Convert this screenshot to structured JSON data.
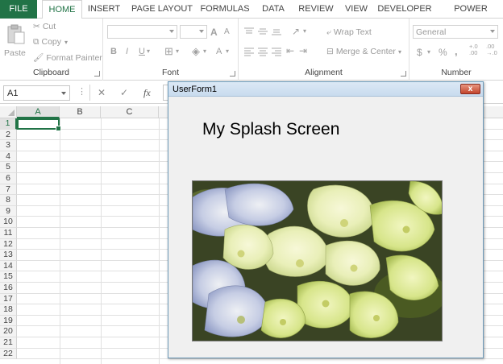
{
  "ribbon": {
    "tabs": [
      {
        "label": "FILE"
      },
      {
        "label": "HOME"
      },
      {
        "label": "INSERT"
      },
      {
        "label": "PAGE LAYOUT"
      },
      {
        "label": "FORMULAS"
      },
      {
        "label": "DATA"
      },
      {
        "label": "REVIEW"
      },
      {
        "label": "VIEW"
      },
      {
        "label": "DEVELOPER"
      },
      {
        "label": "POWER QUERY"
      }
    ],
    "active_tab": "HOME",
    "clipboard": {
      "paste": "Paste",
      "cut": "Cut",
      "copy": "Copy",
      "format_painter": "Format Painter",
      "label": "Clipboard"
    },
    "font": {
      "label": "Font",
      "bold": "B",
      "italic": "I",
      "underline": "U",
      "grow": "A",
      "shrink": "A",
      "font_color": "A"
    },
    "alignment": {
      "label": "Alignment",
      "wrap_text": "Wrap Text",
      "merge_center": "Merge & Center"
    },
    "number": {
      "label": "Number",
      "format": "General",
      "currency": "$",
      "percent": "%",
      "comma": ",",
      "inc_decimal": "+.0\n.00",
      "dec_decimal": ".00\n→.0"
    }
  },
  "formula_bar": {
    "name_box": "A1",
    "cancel_icon": "✕",
    "enter_icon": "✓",
    "fx": "fx"
  },
  "grid": {
    "columns": [
      "A",
      "B",
      "C"
    ],
    "rows": [
      "1",
      "2",
      "3",
      "4",
      "5",
      "6",
      "7",
      "8",
      "9",
      "10",
      "11",
      "12",
      "13",
      "14",
      "15",
      "16",
      "17",
      "18",
      "19",
      "20",
      "21",
      "22"
    ],
    "active_cell": "A1"
  },
  "userform": {
    "title": "UserForm1",
    "close": "x",
    "heading": "My Splash Screen",
    "image_icon": "hydrangea-photo"
  },
  "colors": {
    "accent": "#217346",
    "dialog_bg": "#f0f0f0",
    "title_bar": "#c8dbee"
  }
}
